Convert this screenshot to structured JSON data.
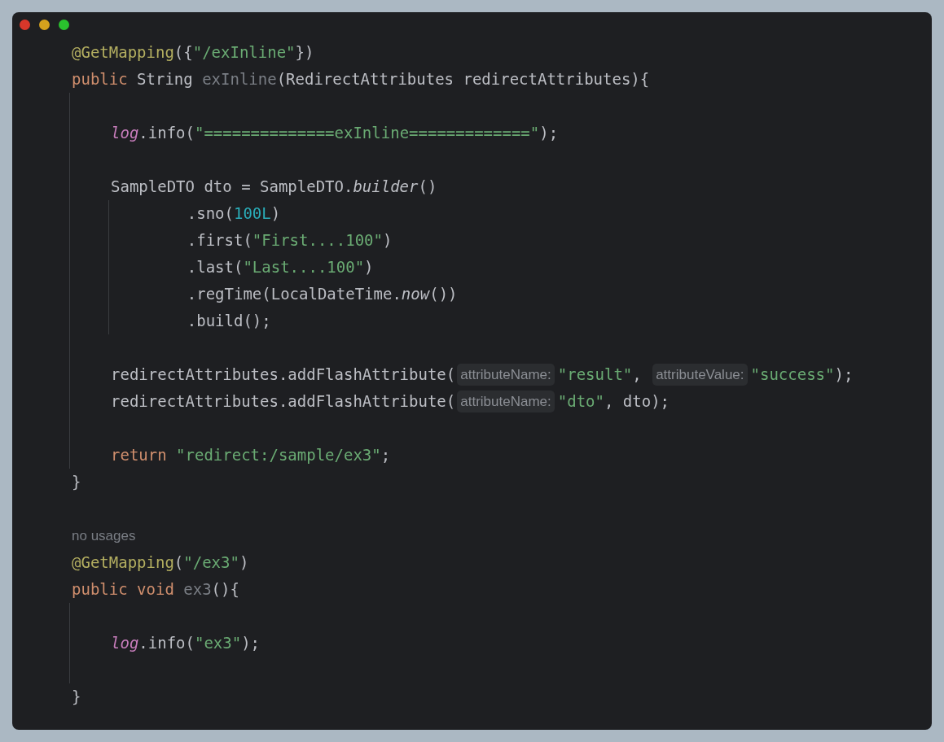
{
  "window": {
    "controls": [
      {
        "color": "#d9372a"
      },
      {
        "color": "#d4a11d"
      },
      {
        "color": "#2ac12e"
      }
    ]
  },
  "lines": [
    {
      "kind": "code",
      "tokens": [
        {
          "kind": "annotation",
          "text": "@GetMapping"
        },
        {
          "kind": "plain",
          "text": "({"
        },
        {
          "kind": "string",
          "text": "\"/exInline\""
        },
        {
          "kind": "plain",
          "text": "})"
        }
      ]
    },
    {
      "kind": "code",
      "tokens": [
        {
          "kind": "keyword",
          "text": "public "
        },
        {
          "kind": "plain",
          "text": "String "
        },
        {
          "kind": "unused",
          "text": "exInline"
        },
        {
          "kind": "plain",
          "text": "(RedirectAttributes redirectAttributes){"
        }
      ],
      "children": [
        {
          "kind": "blank"
        },
        {
          "kind": "code",
          "tokens": [
            {
              "kind": "static",
              "text": "log"
            },
            {
              "kind": "plain",
              "text": ".info("
            },
            {
              "kind": "string",
              "text": "\"==============exInline=============\""
            },
            {
              "kind": "plain",
              "text": ");"
            }
          ]
        },
        {
          "kind": "blank"
        },
        {
          "kind": "code",
          "tokens": [
            {
              "kind": "plain",
              "text": "SampleDTO dto = SampleDTO."
            },
            {
              "kind": "italic",
              "text": "builder"
            },
            {
              "kind": "plain",
              "text": "()"
            }
          ],
          "children": [
            {
              "kind": "code",
              "tokens": [
                {
                  "kind": "plain",
                  "text": "    .sno("
                },
                {
                  "kind": "number",
                  "text": "100L"
                },
                {
                  "kind": "plain",
                  "text": ")"
                }
              ]
            },
            {
              "kind": "code",
              "tokens": [
                {
                  "kind": "plain",
                  "text": "    .first("
                },
                {
                  "kind": "string",
                  "text": "\"First....100\""
                },
                {
                  "kind": "plain",
                  "text": ")"
                }
              ]
            },
            {
              "kind": "code",
              "tokens": [
                {
                  "kind": "plain",
                  "text": "    .last("
                },
                {
                  "kind": "string",
                  "text": "\"Last....100\""
                },
                {
                  "kind": "plain",
                  "text": ")"
                }
              ]
            },
            {
              "kind": "code",
              "tokens": [
                {
                  "kind": "plain",
                  "text": "    .regTime(LocalDateTime."
                },
                {
                  "kind": "italic",
                  "text": "now"
                },
                {
                  "kind": "plain",
                  "text": "())"
                }
              ]
            },
            {
              "kind": "code",
              "tokens": [
                {
                  "kind": "plain",
                  "text": "    .build();"
                }
              ]
            }
          ]
        },
        {
          "kind": "blank"
        },
        {
          "kind": "code",
          "tokens": [
            {
              "kind": "plain",
              "text": "redirectAttributes.addFlashAttribute("
            },
            {
              "kind": "hint",
              "text": "attributeName:"
            },
            {
              "kind": "string",
              "text": "\"result\""
            },
            {
              "kind": "plain",
              "text": ", "
            },
            {
              "kind": "hint",
              "text": "attributeValue:"
            },
            {
              "kind": "string",
              "text": "\"success\""
            },
            {
              "kind": "plain",
              "text": ");"
            }
          ]
        },
        {
          "kind": "code",
          "tokens": [
            {
              "kind": "plain",
              "text": "redirectAttributes.addFlashAttribute("
            },
            {
              "kind": "hint",
              "text": "attributeName:"
            },
            {
              "kind": "string",
              "text": "\"dto\""
            },
            {
              "kind": "plain",
              "text": ", dto);"
            }
          ]
        },
        {
          "kind": "blank"
        },
        {
          "kind": "code",
          "tokens": [
            {
              "kind": "keyword",
              "text": "return "
            },
            {
              "kind": "string",
              "text": "\"redirect:/sample/ex3\""
            },
            {
              "kind": "plain",
              "text": ";"
            }
          ]
        }
      ]
    },
    {
      "kind": "code",
      "tokens": [
        {
          "kind": "plain",
          "text": "}"
        }
      ]
    },
    {
      "kind": "blank"
    },
    {
      "kind": "usages",
      "text": "no usages"
    },
    {
      "kind": "code",
      "tokens": [
        {
          "kind": "annotation",
          "text": "@GetMapping"
        },
        {
          "kind": "plain",
          "text": "("
        },
        {
          "kind": "string",
          "text": "\"/ex3\""
        },
        {
          "kind": "plain",
          "text": ")"
        }
      ]
    },
    {
      "kind": "code",
      "tokens": [
        {
          "kind": "keyword",
          "text": "public void "
        },
        {
          "kind": "unused",
          "text": "ex3"
        },
        {
          "kind": "plain",
          "text": "(){"
        }
      ],
      "children": [
        {
          "kind": "blank"
        },
        {
          "kind": "code",
          "tokens": [
            {
              "kind": "static",
              "text": "log"
            },
            {
              "kind": "plain",
              "text": ".info("
            },
            {
              "kind": "string",
              "text": "\"ex3\""
            },
            {
              "kind": "plain",
              "text": ");"
            }
          ]
        },
        {
          "kind": "blank"
        }
      ]
    },
    {
      "kind": "code",
      "tokens": [
        {
          "kind": "plain",
          "text": "}"
        }
      ]
    }
  ]
}
